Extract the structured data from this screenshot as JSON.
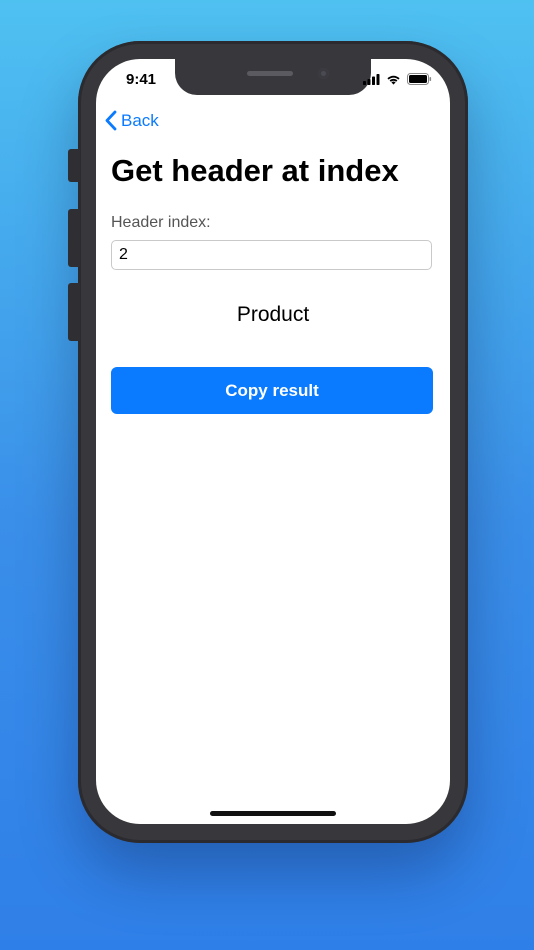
{
  "status_bar": {
    "time": "9:41"
  },
  "nav": {
    "back_label": "Back"
  },
  "page": {
    "title": "Get header at index",
    "field_label": "Header index:",
    "field_value": "2",
    "result": "Product",
    "copy_button_label": "Copy result"
  },
  "colors": {
    "accent": "#0a7aff",
    "background_top": "#4fc1f1",
    "background_bottom": "#2f7fe8",
    "device_frame": "#38383c"
  },
  "icons": [
    "chevron-left-icon",
    "signal-icon",
    "wifi-icon",
    "battery-icon"
  ]
}
